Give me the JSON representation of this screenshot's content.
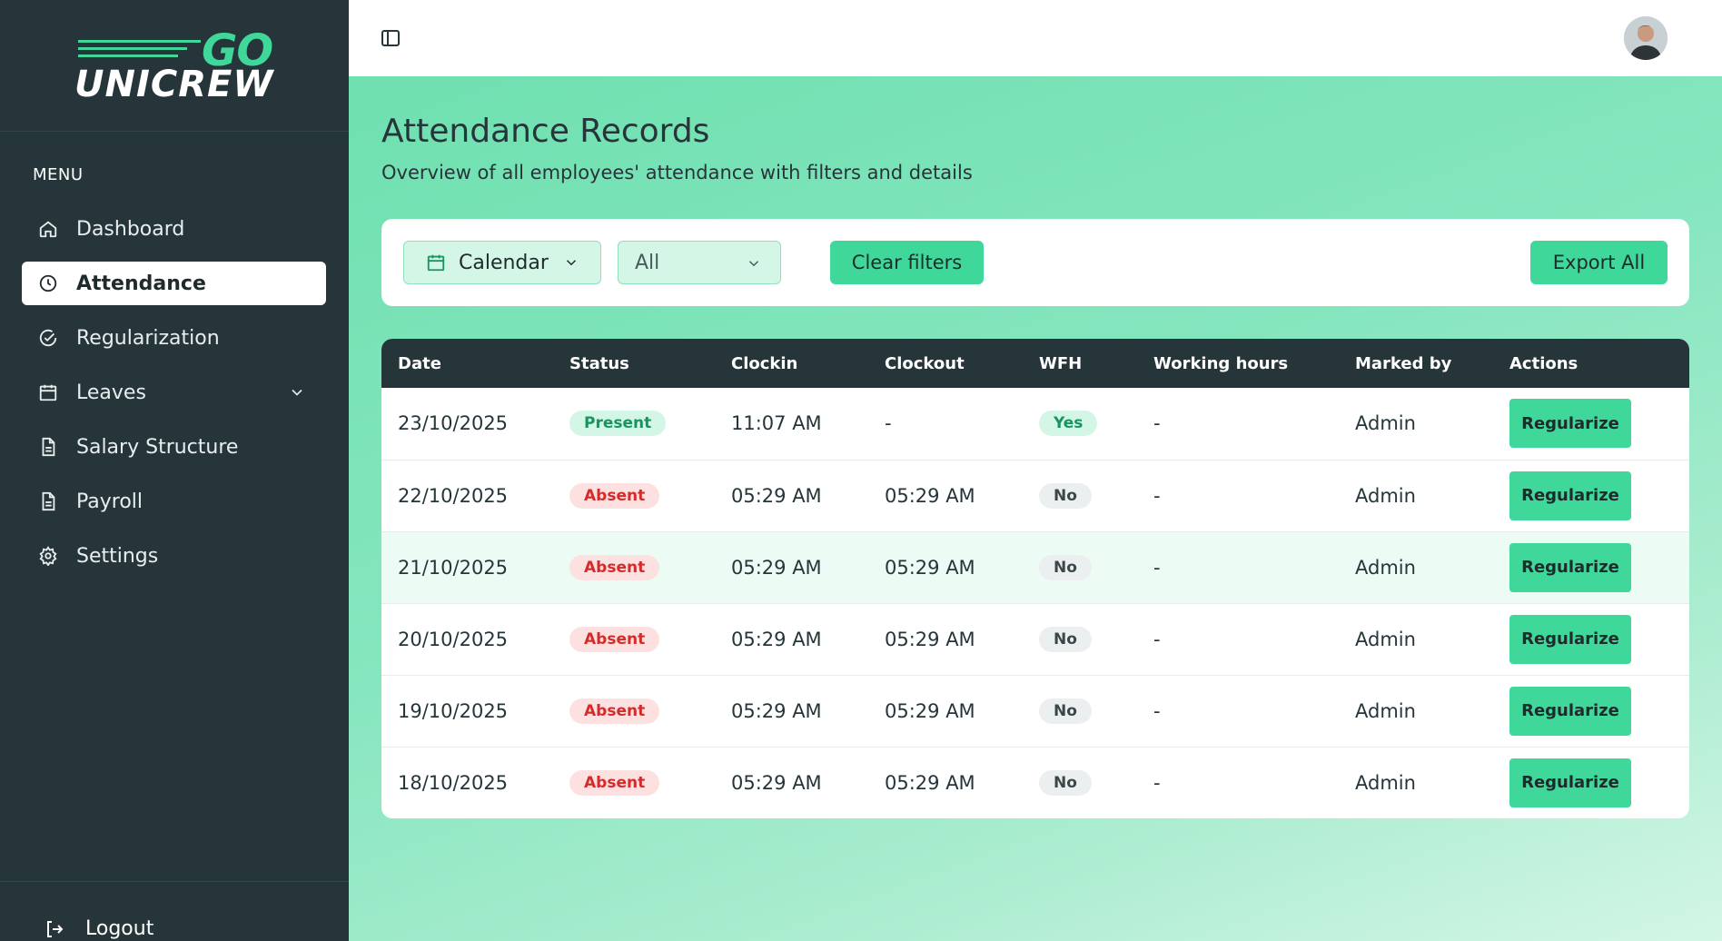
{
  "brand": {
    "logo_top": "GO",
    "logo_bottom": "UNICREW"
  },
  "sidebar": {
    "menu_heading": "MENU",
    "items": [
      {
        "label": "Dashboard",
        "icon": "home-icon"
      },
      {
        "label": "Attendance",
        "icon": "clock-icon",
        "active": true
      },
      {
        "label": "Regularization",
        "icon": "check-circle-icon"
      },
      {
        "label": "Leaves",
        "icon": "calendar-icon",
        "has_submenu": true
      },
      {
        "label": "Salary Structure",
        "icon": "document-icon"
      },
      {
        "label": "Payroll",
        "icon": "document-icon"
      },
      {
        "label": "Settings",
        "icon": "gear-icon"
      }
    ],
    "logout_label": "Logout"
  },
  "page": {
    "title": "Attendance Records",
    "subtitle": "Overview of all employees' attendance with filters and details"
  },
  "filters": {
    "calendar_label": "Calendar",
    "status_select_value": "All",
    "clear_label": "Clear filters",
    "export_label": "Export All"
  },
  "table": {
    "headers": [
      "Date",
      "Status",
      "Clockin",
      "Clockout",
      "WFH",
      "Working hours",
      "Marked by",
      "Actions"
    ],
    "rows": [
      {
        "date": "23/10/2025",
        "status": "Present",
        "clockin": "11:07 AM",
        "clockout": "-",
        "wfh": "Yes",
        "hours": "-",
        "marked_by": "Admin",
        "action": "Regularize"
      },
      {
        "date": "22/10/2025",
        "status": "Absent",
        "clockin": "05:29 AM",
        "clockout": "05:29 AM",
        "wfh": "No",
        "hours": "-",
        "marked_by": "Admin",
        "action": "Regularize"
      },
      {
        "date": "21/10/2025",
        "status": "Absent",
        "clockin": "05:29 AM",
        "clockout": "05:29 AM",
        "wfh": "No",
        "hours": "-",
        "marked_by": "Admin",
        "action": "Regularize"
      },
      {
        "date": "20/10/2025",
        "status": "Absent",
        "clockin": "05:29 AM",
        "clockout": "05:29 AM",
        "wfh": "No",
        "hours": "-",
        "marked_by": "Admin",
        "action": "Regularize"
      },
      {
        "date": "19/10/2025",
        "status": "Absent",
        "clockin": "05:29 AM",
        "clockout": "05:29 AM",
        "wfh": "No",
        "hours": "-",
        "marked_by": "Admin",
        "action": "Regularize"
      },
      {
        "date": "18/10/2025",
        "status": "Absent",
        "clockin": "05:29 AM",
        "clockout": "05:29 AM",
        "wfh": "No",
        "hours": "-",
        "marked_by": "Admin",
        "action": "Regularize"
      }
    ]
  },
  "colors": {
    "sidebar_bg": "#26353a",
    "accent": "#3fd89a",
    "present": "#16955e",
    "absent": "#d42b2b"
  }
}
